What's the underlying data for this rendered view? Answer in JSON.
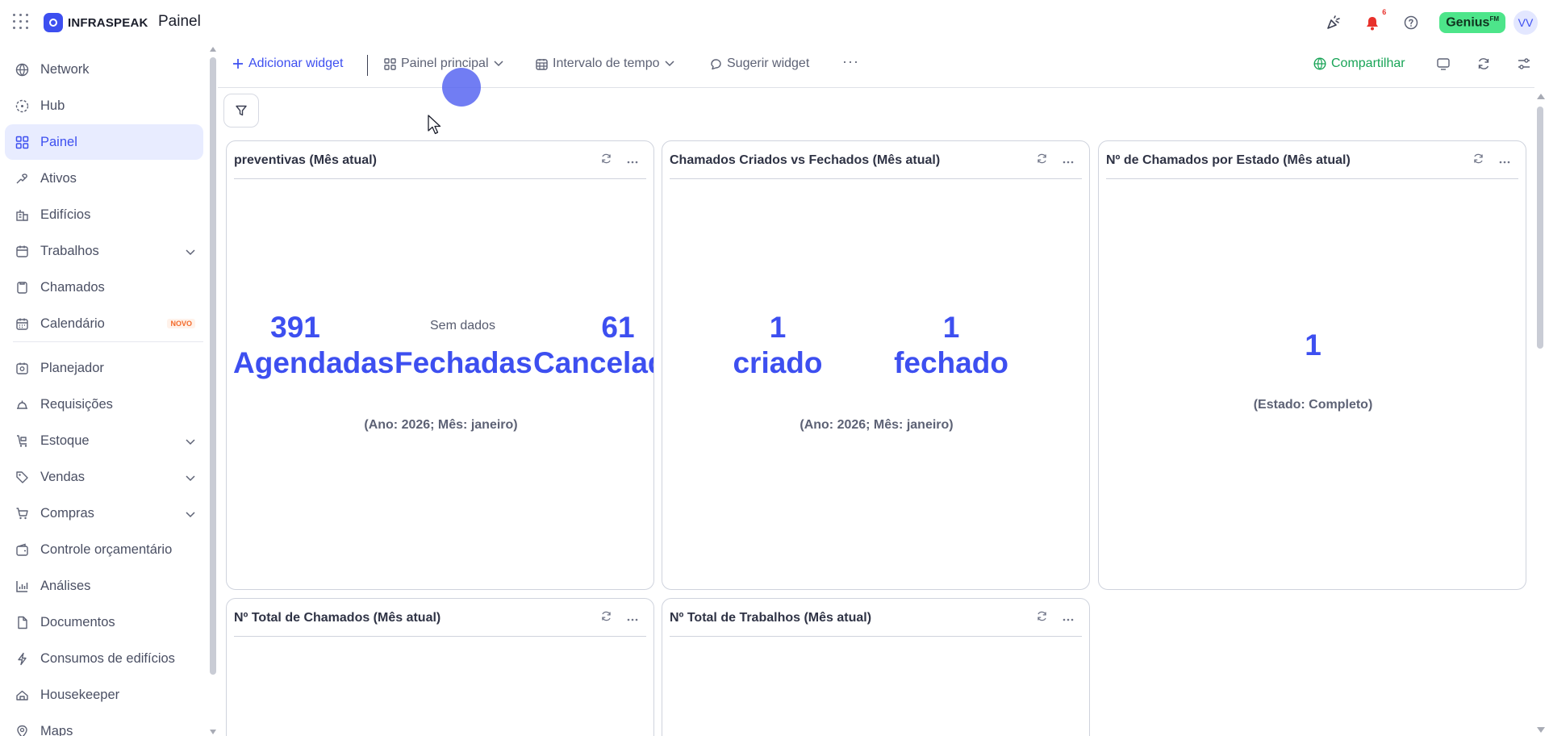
{
  "app": {
    "brand": "INFRASPEAK",
    "page_title": "Painel",
    "notification_count": "6",
    "genius_label": "Genius",
    "genius_sup": "FM",
    "avatar_initials": "VV"
  },
  "sidebar": {
    "items": [
      {
        "label": "Network",
        "icon": "globe-icon"
      },
      {
        "label": "Hub",
        "icon": "hub-icon"
      },
      {
        "label": "Painel",
        "icon": "dashboard-icon",
        "active": true
      },
      {
        "label": "Ativos",
        "icon": "assets-icon"
      },
      {
        "label": "Edifícios",
        "icon": "building-icon"
      },
      {
        "label": "Trabalhos",
        "icon": "work-icon",
        "expandable": true
      },
      {
        "label": "Chamados",
        "icon": "ticket-icon"
      },
      {
        "label": "Calendário",
        "icon": "calendar-icon",
        "badge": "NOVO"
      },
      {
        "label": "Planejador",
        "icon": "planner-icon"
      },
      {
        "label": "Requisições",
        "icon": "bell-service-icon"
      },
      {
        "label": "Estoque",
        "icon": "stock-icon",
        "expandable": true
      },
      {
        "label": "Vendas",
        "icon": "tag-icon",
        "expandable": true
      },
      {
        "label": "Compras",
        "icon": "cart-icon",
        "expandable": true
      },
      {
        "label": "Controle orçamentário",
        "icon": "wallet-icon"
      },
      {
        "label": "Análises",
        "icon": "chart-icon"
      },
      {
        "label": "Documentos",
        "icon": "document-icon"
      },
      {
        "label": "Consumos de edifícios",
        "icon": "bolt-icon"
      },
      {
        "label": "Housekeeper",
        "icon": "housekeeper-icon"
      },
      {
        "label": "Maps",
        "icon": "map-pin-icon"
      }
    ]
  },
  "toolbar": {
    "add_widget": "Adicionar widget",
    "dashboard_select": "Painel principal",
    "time_interval": "Intervalo de tempo",
    "suggest_widget": "Sugerir widget",
    "more": "···",
    "share": "Compartilhar"
  },
  "widgets": {
    "preventivas": {
      "title": "preventivas (Mês atual)",
      "scheduled_value": "391",
      "scheduled_label": "Agendadas",
      "no_data": "Sem dados",
      "closed_label": "Fechadas",
      "cancelled_value": "61",
      "cancelled_label": "Cancelad",
      "period": "(Ano: 2026; Mês: janeiro)"
    },
    "created_vs_closed": {
      "title": "Chamados Criados vs Fechados (Mês atual)",
      "created_value": "1",
      "created_label": "criado",
      "closed_value": "1",
      "closed_label": "fechado",
      "period": "(Ano: 2026; Mês: janeiro)"
    },
    "by_state": {
      "title": "Nº de Chamados por Estado (Mês atual)",
      "value": "1",
      "state": "(Estado: Completo)"
    },
    "total_tickets": {
      "title": "Nº Total de Chamados (Mês atual)"
    },
    "total_works": {
      "title": "Nº Total de Trabalhos (Mês atual)"
    }
  },
  "colors": {
    "accent": "#3d4ff0",
    "share": "#19a457",
    "genius": "#4de58a",
    "notification": "#e8312b"
  }
}
